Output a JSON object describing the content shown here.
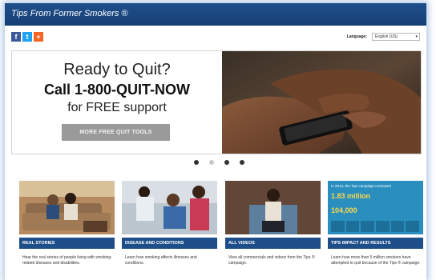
{
  "header": {
    "site_title": "Tips From Former Smokers ®"
  },
  "social": [
    {
      "name": "facebook",
      "glyph": "f",
      "color": "#3b5998"
    },
    {
      "name": "twitter",
      "glyph": "t",
      "color": "#1da1f2"
    },
    {
      "name": "share",
      "glyph": "+",
      "color": "#f26522"
    }
  ],
  "language": {
    "label": "Language:",
    "selected": "English (US)"
  },
  "hero": {
    "line1": "Ready to Quit?",
    "line2": "Call 1-800-QUIT-NOW",
    "line3": "for FREE support",
    "cta": "MORE FREE QUIT TOOLS"
  },
  "carousel": {
    "active_index": 0,
    "dot_count": 4
  },
  "cards": [
    {
      "label": "REAL STORIES",
      "desc": "Hear the real stories of people living with smoking-related diseases and disabilities."
    },
    {
      "label": "DISEASE AND CONDITIONS",
      "desc": "Learn how smoking affects illnesses and conditions."
    },
    {
      "label": "ALL VIDEOS",
      "desc": "View all commercials and videos from the Tips ® campaign."
    },
    {
      "label": "TIPS IMPACT AND RESULTS",
      "desc": "Learn how more than 5 million smokers have attempted to quit because of the Tips ® campaign."
    }
  ],
  "impact_panel": {
    "line1": "In 2014, the Tips campaign motivated",
    "stat1": "1.83 million",
    "stat2": "104,000"
  },
  "colors": {
    "header_blue": "#1d4e89",
    "cta_gray": "#9a9a9a"
  }
}
